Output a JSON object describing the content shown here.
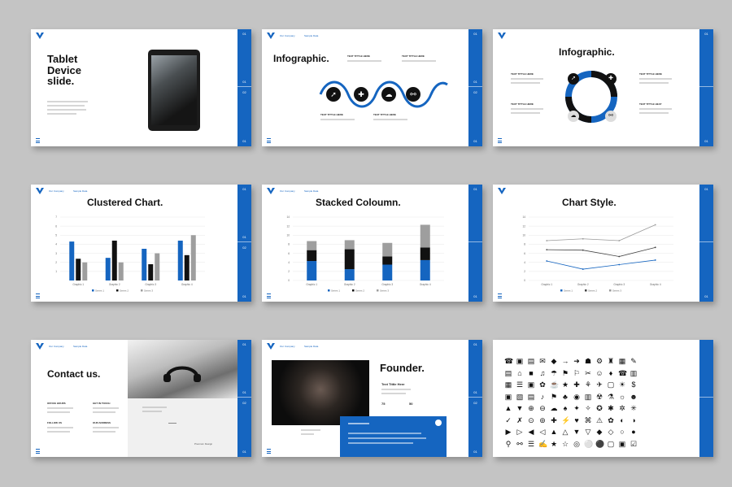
{
  "colors": {
    "accent": "#1565c0",
    "background": "#c4c4c4",
    "dark": "#111111",
    "gray": "#9e9e9e"
  },
  "nav": {
    "link_a": "Our Company",
    "link_b": "Sample Data"
  },
  "sidebar": {
    "num_top": "01",
    "num_mid_a": "01",
    "num_mid_b": "02",
    "num_bottom": "01"
  },
  "slide1": {
    "title_lines": [
      "Tablet",
      "Device",
      "slide."
    ]
  },
  "slide2": {
    "title": "Infographic.",
    "labels": [
      "TEXT TITTLE HERE",
      "TEXT TITTLE HERE",
      "TEXT TITTLE HERE",
      "TEXT TITTLE HERE"
    ],
    "icons": [
      "rocket-icon",
      "puzzle-icon",
      "cloud-icon",
      "link-icon"
    ]
  },
  "slide3": {
    "title": "Infographic.",
    "labels": [
      "TEXT TITTLE HERE",
      "TEXT TITTLE HERE",
      "TEXT TITTLE HERE",
      "TEXT TITTLE HEAT"
    ],
    "icons": [
      "rocket-icon",
      "puzzle-icon",
      "cloud-icon",
      "link-icon"
    ]
  },
  "slide4": {
    "title": "Clustered Chart.",
    "chart_data": {
      "type": "bar",
      "categories": [
        "Graphic 1",
        "Graphic 2",
        "Graphic 3",
        "Graphic 4"
      ],
      "ylim": [
        0,
        7
      ],
      "yticks": [
        "1",
        "2",
        "3",
        "4",
        "5",
        "6",
        "7"
      ],
      "series": [
        {
          "name": "Series 1",
          "color": "#1565c0",
          "values": [
            4.3,
            2.5,
            3.5,
            4.4
          ]
        },
        {
          "name": "Series 2",
          "color": "#111111",
          "values": [
            2.4,
            4.4,
            1.8,
            2.8
          ]
        },
        {
          "name": "Series 3",
          "color": "#9e9e9e",
          "values": [
            2,
            2,
            3,
            5
          ]
        }
      ]
    }
  },
  "slide5": {
    "title": "Stacked Coloumn.",
    "chart_data": {
      "type": "bar",
      "stacked": true,
      "categories": [
        "Graphic 1",
        "Graphic 2",
        "Graphic 3",
        "Graphic 4"
      ],
      "ylim": [
        0,
        14
      ],
      "yticks": [
        "0",
        "2",
        "4",
        "6",
        "8",
        "10",
        "12",
        "14"
      ],
      "series": [
        {
          "name": "Series 1",
          "color": "#1565c0",
          "values": [
            4.3,
            2.5,
            3.5,
            4.5
          ]
        },
        {
          "name": "Series 2",
          "color": "#111111",
          "values": [
            2.4,
            4.4,
            1.8,
            2.8
          ]
        },
        {
          "name": "Series 3",
          "color": "#9e9e9e",
          "values": [
            2,
            2,
            3,
            5
          ]
        }
      ]
    }
  },
  "slide6": {
    "title": "Chart Style.",
    "chart_data": {
      "type": "line",
      "categories": [
        "Graphic 1",
        "Graphic 2",
        "Graphic 3",
        "Graphic 4"
      ],
      "ylim": [
        0,
        14
      ],
      "yticks": [
        "0",
        "2",
        "4",
        "6",
        "8",
        "10",
        "12",
        "14"
      ],
      "series": [
        {
          "name": "Series 1",
          "color": "#1565c0",
          "values": [
            4.3,
            2.5,
            3.5,
            4.5
          ]
        },
        {
          "name": "Series 2",
          "color": "#444444",
          "values": [
            6.8,
            6.7,
            5.3,
            7.3
          ]
        },
        {
          "name": "Series 3",
          "color": "#999999",
          "values": [
            8.8,
            9.2,
            8.8,
            12.3
          ]
        }
      ]
    }
  },
  "slide7": {
    "title": "Contact us.",
    "labels": [
      "OFFICE HOURS",
      "GET IN TOUCH",
      "FOLLOW US",
      "OUR ADDRESS"
    ],
    "footer": "Premium Design"
  },
  "slide8": {
    "title": "Founder.",
    "subtitle": "Text Tittle Here",
    "stat_a": "75",
    "stat_b": "50"
  },
  "slide9": {
    "rows": [
      [
        "☎",
        "▣",
        "▤",
        "✉",
        "◆",
        "→",
        "➜",
        "☗",
        "⚙",
        "♜",
        "▦",
        "✎"
      ],
      [
        "▤",
        "⌂",
        "■",
        "♫",
        "☂",
        "⚑",
        "⚐",
        "✂",
        "☺",
        "♦",
        "☎",
        "▥"
      ],
      [
        "▦",
        "☰",
        "▣",
        "✿",
        "☕",
        "★",
        "✚",
        "⚘",
        "✈",
        "▢",
        "☀",
        "$"
      ],
      [
        "▣",
        "▧",
        "▤",
        "♪",
        "⚑",
        "♣",
        "◉",
        "▥",
        "☢",
        "⚗",
        "☼",
        "☻"
      ],
      [
        "▲",
        "▼",
        "⊕",
        "⊖",
        "☁",
        "♠",
        "✦",
        "✧",
        "✪",
        "✱",
        "✲",
        "✳"
      ],
      [
        "✓",
        "✗",
        "⊙",
        "⊚",
        "✚",
        "⚡",
        "♥",
        "⌘",
        "⚠",
        "✿",
        "◐",
        "◑"
      ],
      [
        "▶",
        "▷",
        "◀",
        "◁",
        "▲",
        "△",
        "▼",
        "▽",
        "◆",
        "◇",
        "○",
        "●"
      ],
      [
        "⚲",
        "⚯",
        "☰",
        "✍",
        "★",
        "☆",
        "◎",
        "⚪",
        "⚫",
        "▢",
        "▣",
        "☑"
      ]
    ]
  }
}
